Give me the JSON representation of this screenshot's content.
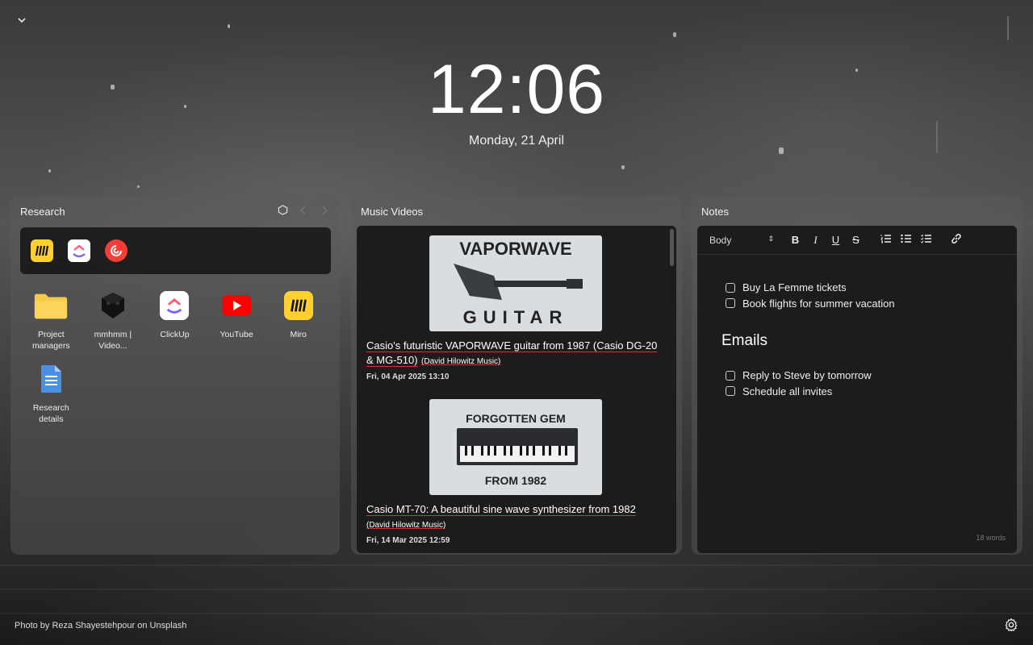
{
  "clock": {
    "time": "12:06",
    "date": "Monday, 21 April"
  },
  "research": {
    "title": "Research",
    "dock": [
      "miro-icon",
      "clickup-icon",
      "pocketcasts-icon"
    ],
    "apps": [
      {
        "label": "Project managers",
        "icon": "folder-icon"
      },
      {
        "label": "mmhmm | Video...",
        "icon": "mmhmm-icon"
      },
      {
        "label": "ClickUp",
        "icon": "clickup-icon"
      },
      {
        "label": "YouTube",
        "icon": "youtube-icon"
      },
      {
        "label": "Miro",
        "icon": "miro-icon"
      },
      {
        "label": "Research details",
        "icon": "doc-icon"
      }
    ]
  },
  "music": {
    "title": "Music Videos",
    "videos": [
      {
        "thumb_top": "VAPORWAVE",
        "thumb_bottom": "GUITAR",
        "title": "Casio's futuristic VAPORWAVE guitar from 1987 (Casio DG-20 & MG-510)",
        "channel": "(David Hilowitz Music)",
        "date": "Fri, 04 Apr 2025 13:10"
      },
      {
        "thumb_top": "FORGOTTEN GEM",
        "thumb_bottom": "FROM 1982",
        "title": "Casio MT-70: A beautiful sine wave synthesizer from 1982",
        "channel": "(David Hilowitz Music)",
        "date": "Fri, 14 Mar 2025 12:59"
      }
    ]
  },
  "notes": {
    "title": "Notes",
    "style": "Body",
    "todos_a": [
      "Buy La Femme tickets",
      "Book flights for summer vacation"
    ],
    "heading": "Emails",
    "todos_b": [
      "Reply to Steve by tomorrow",
      "Schedule all invites"
    ],
    "word_count": "18 words"
  },
  "credit": "Photo by Reza Shayestehpour on Unsplash",
  "colors": {
    "accent_red": "#e0302b",
    "miro_yellow": "#ffd02f",
    "youtube_red": "#ff0000"
  }
}
